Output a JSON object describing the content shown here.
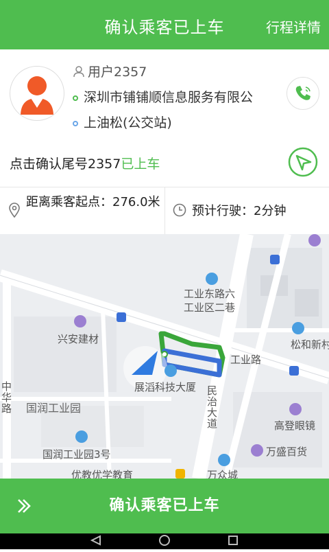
{
  "header": {
    "title": "确认乘客已上车",
    "detail_link": "行程详情"
  },
  "passenger": {
    "user": "用户2357",
    "start": "深圳市铺铺顺信息服务有限公",
    "destination": "上油松(公交站)"
  },
  "confirm": {
    "prefix": "点击确认尾号2357",
    "highlight": "已上车"
  },
  "info": {
    "distance": "距离乘客起点：276.0米",
    "eta": "预计行驶：2分钟"
  },
  "map": {
    "labels": {
      "gongye_east": "工业东路六",
      "gongye_zone": "工业区二巷",
      "xingan": "兴安建材",
      "zhonghua": "中华路",
      "guorun": "国润工业园",
      "guorun3": "国润工业园3号",
      "zhanzi": "展滔科技大厦",
      "minzhi": "民治大道",
      "gongyelu": "工业路",
      "gaodeng": "高登眼镜",
      "wansheng": "万盛百货",
      "wanzhong": "万众城",
      "youjiao": "优教优学教育",
      "songhe": "松和新村"
    }
  },
  "bottom": {
    "confirm_button": "确认乘客已上车"
  },
  "colors": {
    "brand": "#4fbd4f",
    "route_green": "#3aa63a",
    "route_blue": "#3b6fd6"
  }
}
